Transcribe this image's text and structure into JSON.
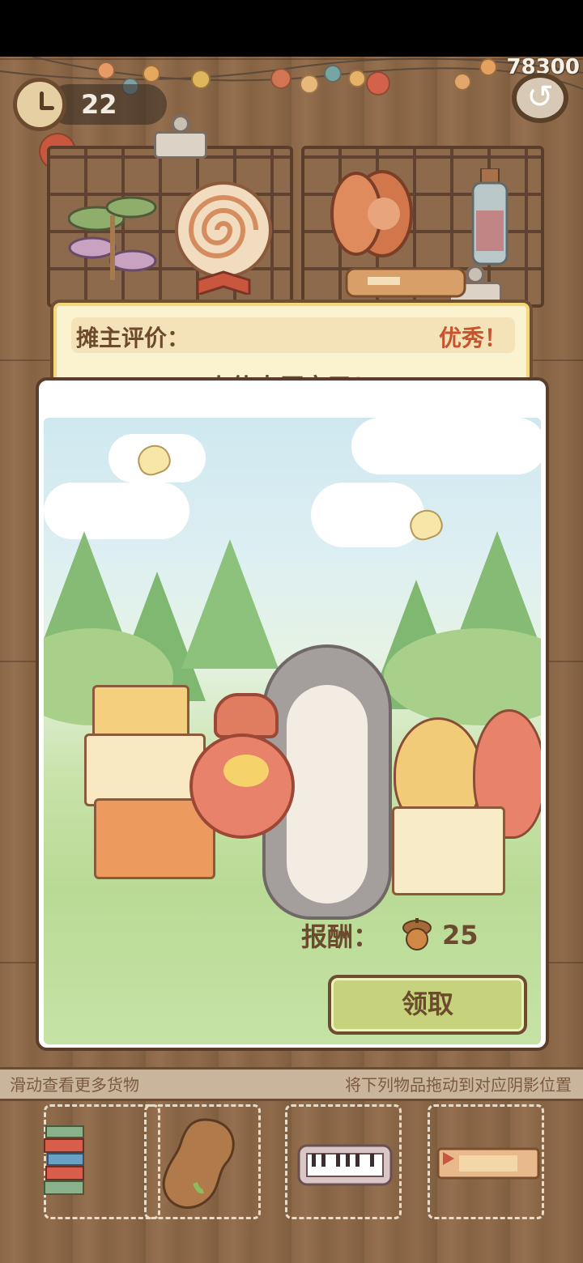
{
  "hud": {
    "timer": "22",
    "score": "78300",
    "clock_icon": "clock-icon",
    "back_icon": "back-arrow-icon"
  },
  "banner": {
    "label": "摊主评价：",
    "grade": "优秀！",
    "comment": "小伙太厉害了！"
  },
  "reward": {
    "label": "报酬：",
    "amount": "25",
    "icon": "acorn-icon"
  },
  "claim_button": "领取",
  "tray": {
    "left_hint": "滑动查看更多货物",
    "right_hint": "将下列物品拖动到对应阴影位置",
    "items": [
      "book-stack-icon",
      "peanut-icon",
      "keyboard-icon",
      "cookie-box-icon"
    ]
  },
  "colors": {
    "wood": "#8a6748",
    "banner_bg": "#fbf2cf",
    "grade": "#c6542c",
    "button": "#c6d27c",
    "text_brown": "#6b4a2e"
  }
}
